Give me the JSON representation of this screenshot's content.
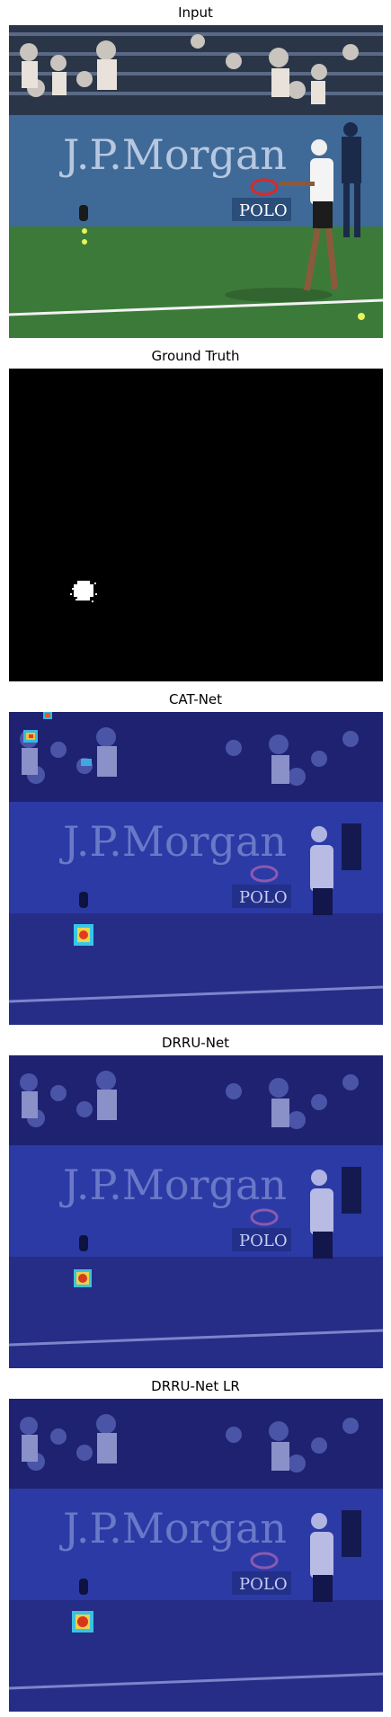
{
  "figure": {
    "panels": [
      {
        "title": "Input",
        "kind": "scene",
        "overlay": "none"
      },
      {
        "title": "Ground Truth",
        "kind": "mask",
        "overlay": "none"
      },
      {
        "title": "CAT-Net",
        "kind": "scene",
        "overlay": "heatmap",
        "hotspots": "ball-and-top-left"
      },
      {
        "title": "DRRU-Net",
        "kind": "scene",
        "overlay": "heatmap",
        "hotspots": "ball"
      },
      {
        "title": "DRRU-Net LR",
        "kind": "scene",
        "overlay": "heatmap",
        "hotspots": "ball"
      }
    ],
    "scene_text": {
      "sponsor": "J.P.Morgan",
      "sign": "POLO"
    },
    "colors": {
      "court": "#3c7a3a",
      "wall": "#3f6a98",
      "heat_overlay": "#1e28b4",
      "mask_region": "#ffffff",
      "mask_background": "#000000"
    }
  }
}
